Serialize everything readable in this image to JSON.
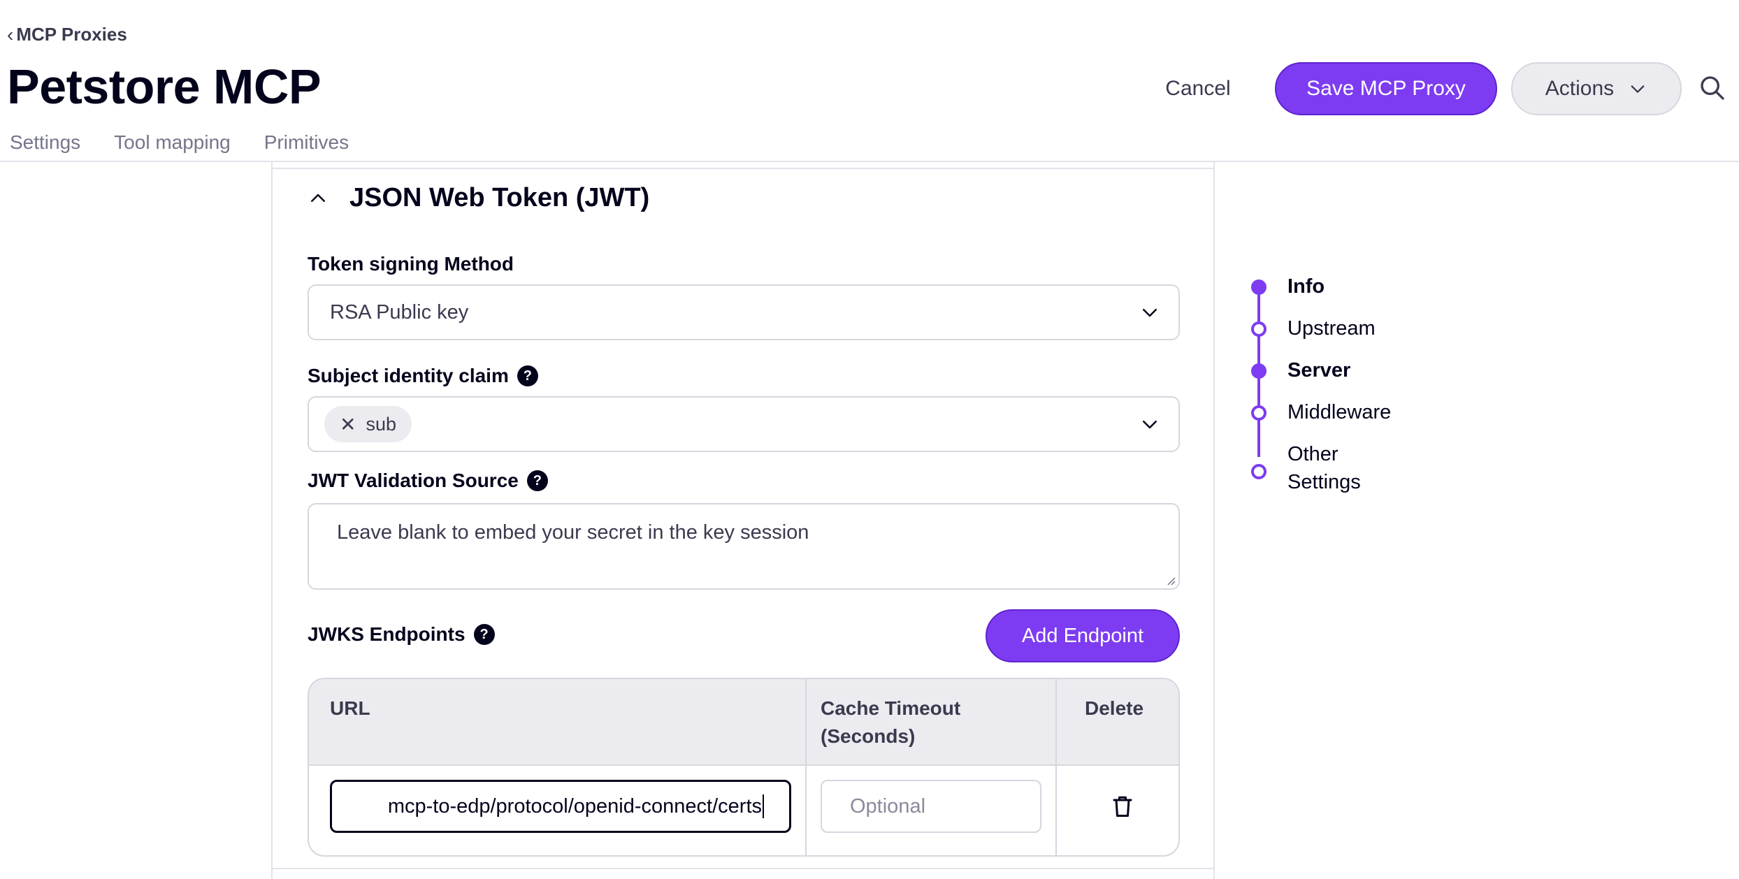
{
  "header": {
    "back_label": "MCP Proxies",
    "title": "Petstore MCP",
    "tabs": [
      {
        "label": "Settings"
      },
      {
        "label": "Tool mapping"
      },
      {
        "label": "Primitives"
      }
    ],
    "cancel_label": "Cancel",
    "save_label": "Save MCP Proxy",
    "actions_label": "Actions"
  },
  "jwt_section": {
    "title": "JSON Web Token (JWT)",
    "signing_method": {
      "label": "Token signing Method",
      "value": "RSA Public key"
    },
    "subject_claim": {
      "label": "Subject identity claim",
      "chips": [
        "sub"
      ]
    },
    "validation_source": {
      "label": "JWT Validation Source",
      "placeholder": "Leave blank to embed your secret in the key session"
    },
    "jwks": {
      "label": "JWKS Endpoints",
      "add_label": "Add Endpoint",
      "columns": [
        "URL",
        "Cache Timeout\n(Seconds)",
        "Delete"
      ],
      "rows": [
        {
          "url": "mcp-to-edp/protocol/openid-connect/certs",
          "timeout_placeholder": "Optional"
        }
      ]
    }
  },
  "stepper": {
    "steps": [
      {
        "label": "Info",
        "active": true
      },
      {
        "label": "Upstream",
        "active": false
      },
      {
        "label": "Server",
        "active": true
      },
      {
        "label": "Middleware",
        "active": false
      },
      {
        "label": "Other Settings",
        "active": false
      }
    ]
  },
  "colors": {
    "accent": "#7d3cf1",
    "text": "#03031c",
    "muted": "#75758a",
    "border": "#d6d6df"
  }
}
